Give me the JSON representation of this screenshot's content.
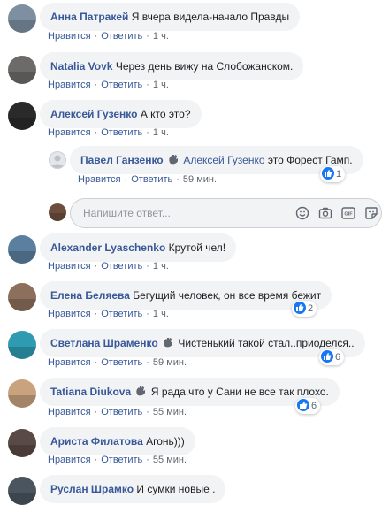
{
  "comments": [
    {
      "author": "Анна Патракей",
      "text": "Я вчера видела-начало Правды",
      "like": "Нравится",
      "reply": "Ответить",
      "time": "1 ч.",
      "avatar_color": "#7d8fa1"
    },
    {
      "author": "Natalia Vovk",
      "text": "Через день вижу на Слобожанском.",
      "like": "Нравится",
      "reply": "Ответить",
      "time": "1 ч.",
      "avatar_color": "#6d6a6a"
    },
    {
      "author": "Алексей Гузенко",
      "text": "А кто это?",
      "like": "Нравится",
      "reply": "Ответить",
      "time": "1 ч.",
      "avatar_color": "#2a2a2a"
    },
    {
      "author": "Alexander Lyaschenko",
      "text": "Крутой чел!",
      "like": "Нравится",
      "reply": "Ответить",
      "time": "1 ч.",
      "avatar_color": "#5b7f9e"
    },
    {
      "author": "Елена Беляева",
      "text": "Бегущий человек, он все время бежит",
      "like": "Нравится",
      "reply": "Ответить",
      "time": "1 ч.",
      "reactions": "2",
      "avatar_color": "#8c6f5c"
    },
    {
      "author": "Светлана Шраменко",
      "text": "Чистенький такой стал..приоделся..",
      "like": "Нравится",
      "reply": "Ответить",
      "time": "59 мин.",
      "reactions": "6",
      "avatar_color": "#2f9bb0"
    },
    {
      "author": "Tatiana Diukova",
      "text": "Я рада,что у Сани не все так плохо.",
      "like": "Нравится",
      "reply": "Ответить",
      "time": "55 мин.",
      "reactions": "6",
      "avatar_color": "#c9a27e"
    },
    {
      "author": "Ариста Филатова",
      "text": "Агонь)))",
      "like": "Нравится",
      "reply": "Ответить",
      "time": "55 мин.",
      "avatar_color": "#5a4a45"
    },
    {
      "author": "Руслан Шрамко",
      "text": "И сумки новые .",
      "avatar_color": "#4a5560"
    }
  ],
  "reply": {
    "author": "Павел Ганзенко",
    "mention": "Алексей Гузенко",
    "text": "это Форест Гамп.",
    "like": "Нравится",
    "reply": "Ответить",
    "time": "59 мин.",
    "reactions": "1",
    "avatar_color": "#e4e6eb"
  },
  "reply_box": {
    "placeholder": "Напишите ответ...",
    "avatar_color": "#6b4e3d"
  },
  "colors": {
    "link": "#385898",
    "bubble": "#f2f3f5",
    "meta": "#606770",
    "like": "#1877f2"
  }
}
